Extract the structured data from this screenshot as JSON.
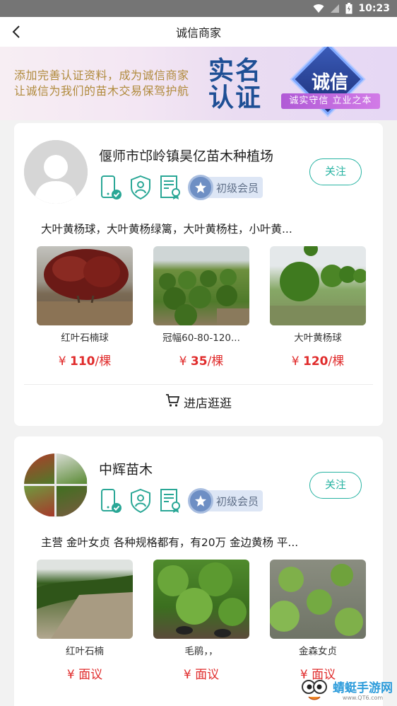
{
  "status_bar": {
    "time": "10:23"
  },
  "header": {
    "title": "诚信商家"
  },
  "banner": {
    "line1": "添加完善认证资料，成为诚信商家",
    "line2": "让诚信为我们的苗木交易保驾护航",
    "big_line1": "实名",
    "big_line2": "认证",
    "badge_word": "诚信",
    "badge_slogan": "诚实守信 立业之本"
  },
  "shops": [
    {
      "name": "偃师市邙岭镇昊亿苗木种植场",
      "follow_label": "关注",
      "member_level": "初级会员",
      "description": "大叶黄杨球，大叶黄杨绿篱，大叶黄杨柱，小叶黄...",
      "products": [
        {
          "name": "红叶石楠球",
          "price_symbol": "¥",
          "price": "110",
          "unit": "/棵"
        },
        {
          "name": "冠幅60-80-120...",
          "price_symbol": "¥",
          "price": "35",
          "unit": "/棵"
        },
        {
          "name": "大叶黄杨球",
          "price_symbol": "¥",
          "price": "120",
          "unit": "/棵"
        }
      ],
      "visit_label": "进店逛逛"
    },
    {
      "name": "中辉苗木",
      "follow_label": "关注",
      "member_level": "初级会员",
      "description": "主营 金叶女贞 各种规格都有，有20万 金边黄杨 平...",
      "products": [
        {
          "name": "红叶石楠",
          "price_symbol": "¥",
          "price": "面议",
          "unit": ""
        },
        {
          "name": "毛鹃，，",
          "price_symbol": "¥",
          "price": "面议",
          "unit": ""
        },
        {
          "name": "金森女贞",
          "price_symbol": "¥",
          "price": "面议",
          "unit": ""
        }
      ]
    }
  ],
  "watermark": {
    "name": "蜻蜓手游网",
    "url": "www.QT6.com"
  },
  "colors": {
    "accent": "#27b3a2",
    "price": "#e02b2b",
    "member_bg": "#dde6f5"
  },
  "icons": [
    "back-arrow-icon",
    "wifi-icon",
    "signal-icon",
    "battery-icon",
    "phone-verified-icon",
    "shield-user-icon",
    "certificate-icon",
    "member-medal-icon",
    "cart-icon"
  ]
}
